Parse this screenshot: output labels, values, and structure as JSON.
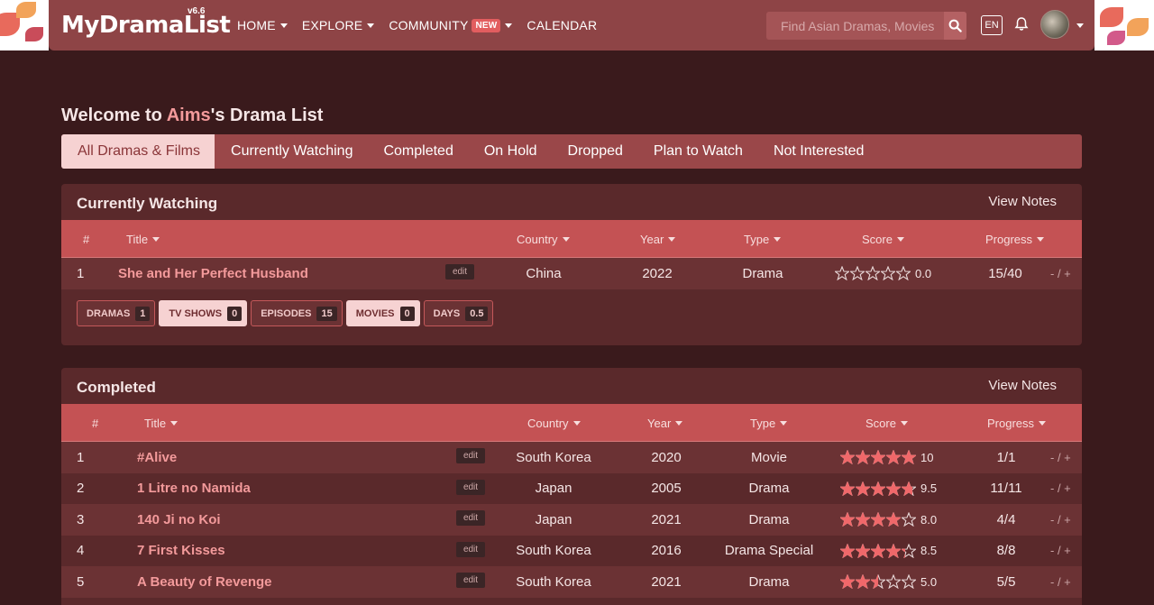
{
  "nav": {
    "logo": "MyDramaList",
    "version": "v6.6",
    "menu": [
      {
        "label": "HOME",
        "has_caret": true
      },
      {
        "label": "EXPLORE",
        "has_caret": true
      },
      {
        "label": "COMMUNITY",
        "has_caret": true,
        "badge": "NEW"
      },
      {
        "label": "CALENDAR",
        "has_caret": false
      }
    ],
    "search_placeholder": "Find Asian Dramas, Movies",
    "lang": "EN",
    "icons": [
      "search-icon",
      "bell-icon",
      "avatar"
    ]
  },
  "welcome": {
    "prefix": "Welcome to ",
    "username": "Aims",
    "suffix": "'s Drama List"
  },
  "tabs": [
    "All Dramas & Films",
    "Currently Watching",
    "Completed",
    "On Hold",
    "Dropped",
    "Plan to Watch",
    "Not Interested"
  ],
  "currently_watching": {
    "title": "Currently Watching",
    "view_notes": "View Notes",
    "columns": [
      "#",
      "Title",
      "Country",
      "Year",
      "Type",
      "Score",
      "Progress"
    ],
    "rows": [
      {
        "num": "1",
        "title": "She and Her Perfect Husband",
        "edit": "edit",
        "country": "China",
        "year": "2022",
        "type": "Drama",
        "score": 0.0,
        "score_text": "0.0",
        "progress": "15/40",
        "pm": "- / +"
      }
    ],
    "stats": [
      {
        "label": "DRAMAS",
        "count": "1",
        "style": "dark"
      },
      {
        "label": "TV SHOWS",
        "count": "0",
        "style": "light"
      },
      {
        "label": "EPISODES",
        "count": "15",
        "style": "dark"
      },
      {
        "label": "MOVIES",
        "count": "0",
        "style": "light"
      },
      {
        "label": "DAYS",
        "count": "0.5",
        "style": "dark"
      }
    ]
  },
  "completed": {
    "title": "Completed",
    "view_notes": "View Notes",
    "columns": [
      "#",
      "Title",
      "Country",
      "Year",
      "Type",
      "Score",
      "Progress"
    ],
    "rows": [
      {
        "num": "1",
        "title": "#Alive",
        "edit": "edit",
        "country": "South Korea",
        "year": "2020",
        "type": "Movie",
        "score": 10,
        "score_text": "10",
        "progress": "1/1",
        "pm": "- / +"
      },
      {
        "num": "2",
        "title": "1 Litre no Namida",
        "edit": "edit",
        "country": "Japan",
        "year": "2005",
        "type": "Drama",
        "score": 9.5,
        "score_text": "9.5",
        "progress": "11/11",
        "pm": "- / +"
      },
      {
        "num": "3",
        "title": "140 Ji no Koi",
        "edit": "edit",
        "country": "Japan",
        "year": "2021",
        "type": "Drama",
        "score": 8.0,
        "score_text": "8.0",
        "progress": "4/4",
        "pm": "- / +"
      },
      {
        "num": "4",
        "title": "7 First Kisses",
        "edit": "edit",
        "country": "South Korea",
        "year": "2016",
        "type": "Drama Special",
        "score": 8.5,
        "score_text": "8.5",
        "progress": "8/8",
        "pm": "- / +"
      },
      {
        "num": "5",
        "title": "A Beauty of Revenge",
        "edit": "edit",
        "country": "South Korea",
        "year": "2021",
        "type": "Drama",
        "score": 5.0,
        "score_text": "5.0",
        "progress": "5/5",
        "pm": "- / +"
      }
    ]
  },
  "colors": {
    "brand": "#8e4446",
    "accent": "#f39a9b",
    "star_fill": "#f0686a",
    "header_row": "#c45254",
    "background": "#3a1a1c"
  }
}
